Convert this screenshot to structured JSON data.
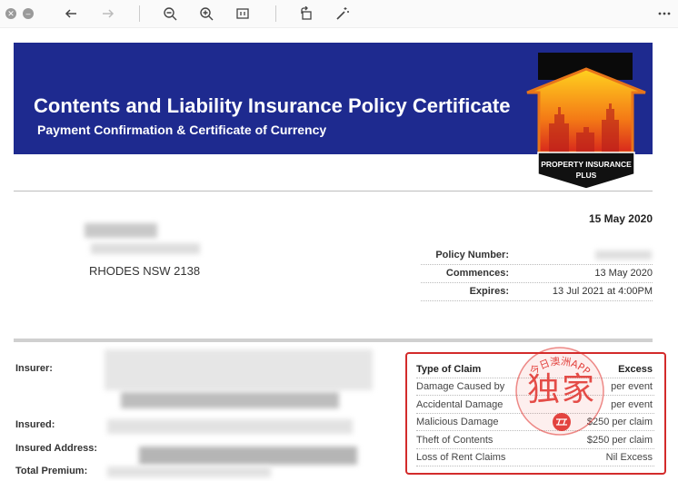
{
  "toolbar": {
    "icons": [
      "close-icon",
      "minimize-icon",
      "back-icon",
      "forward-icon",
      "zoom-out-icon",
      "zoom-in-icon",
      "fit-page-icon",
      "rotate-icon",
      "magic-wand-icon",
      "more-icon"
    ]
  },
  "banner": {
    "title": "Contents and Liability Insurance Policy Certificate",
    "subtitle": "Payment Confirmation & Certificate of Currency",
    "logo_text_1": "PROPERTY INSURANCE",
    "logo_text_2": "PLUS"
  },
  "document": {
    "date": "15 May 2020",
    "address_suburb": "RHODES NSW 2138",
    "policy": [
      {
        "label": "Policy Number:",
        "value": ""
      },
      {
        "label": "Commences:",
        "value": "13 May 2020"
      },
      {
        "label": "Expires:",
        "value": "13 Jul 2021 at 4:00PM"
      }
    ],
    "left_labels": {
      "insurer": "Insurer:",
      "insured": "Insured:",
      "insured_address": "Insured Address:",
      "total_premium": "Total Premium:"
    }
  },
  "claims": {
    "header": {
      "type": "Type of Claim",
      "excess": "Excess"
    },
    "rows": [
      {
        "type": "Damage Caused by",
        "excess": "per event"
      },
      {
        "type": "Accidental Damage",
        "excess": "per event"
      },
      {
        "type": "Malicious Damage",
        "excess": "$250 per claim"
      },
      {
        "type": "Theft of Contents",
        "excess": "$250 per claim"
      },
      {
        "type": "Loss of Rent Claims",
        "excess": "Nil Excess"
      }
    ]
  },
  "watermark": {
    "arc_text": "今日澳洲APP",
    "char1": "独",
    "char2": "家",
    "color": "#e0302b"
  }
}
